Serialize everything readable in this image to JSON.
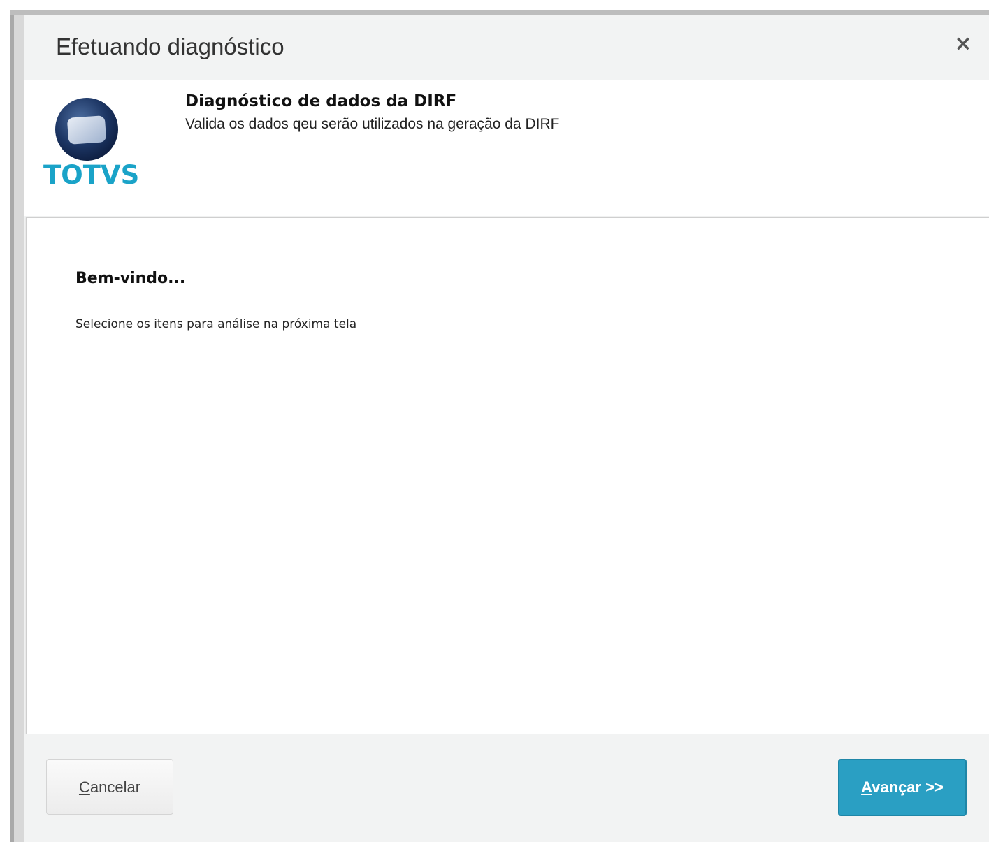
{
  "dialog": {
    "title": "Efetuando diagnóstico",
    "close_label": "×"
  },
  "header": {
    "logo_text": "TOTVS",
    "title": "Diagnóstico de dados da DIRF",
    "description": "Valida os dados qeu serão utilizados na geração da DIRF"
  },
  "content": {
    "welcome": "Bem-vindo...",
    "instruction": "Selecione os itens para análise na próxima tela"
  },
  "footer": {
    "cancel_accesskey": "C",
    "cancel_rest": "ancelar",
    "next_accesskey": "A",
    "next_rest": "vançar >>"
  },
  "colors": {
    "accent": "#2a9fc3",
    "logo": "#1aa3c8"
  },
  "icons": {
    "close": "close-icon",
    "logo": "totvs-logo-icon",
    "cursor": "mouse-cursor-icon"
  }
}
